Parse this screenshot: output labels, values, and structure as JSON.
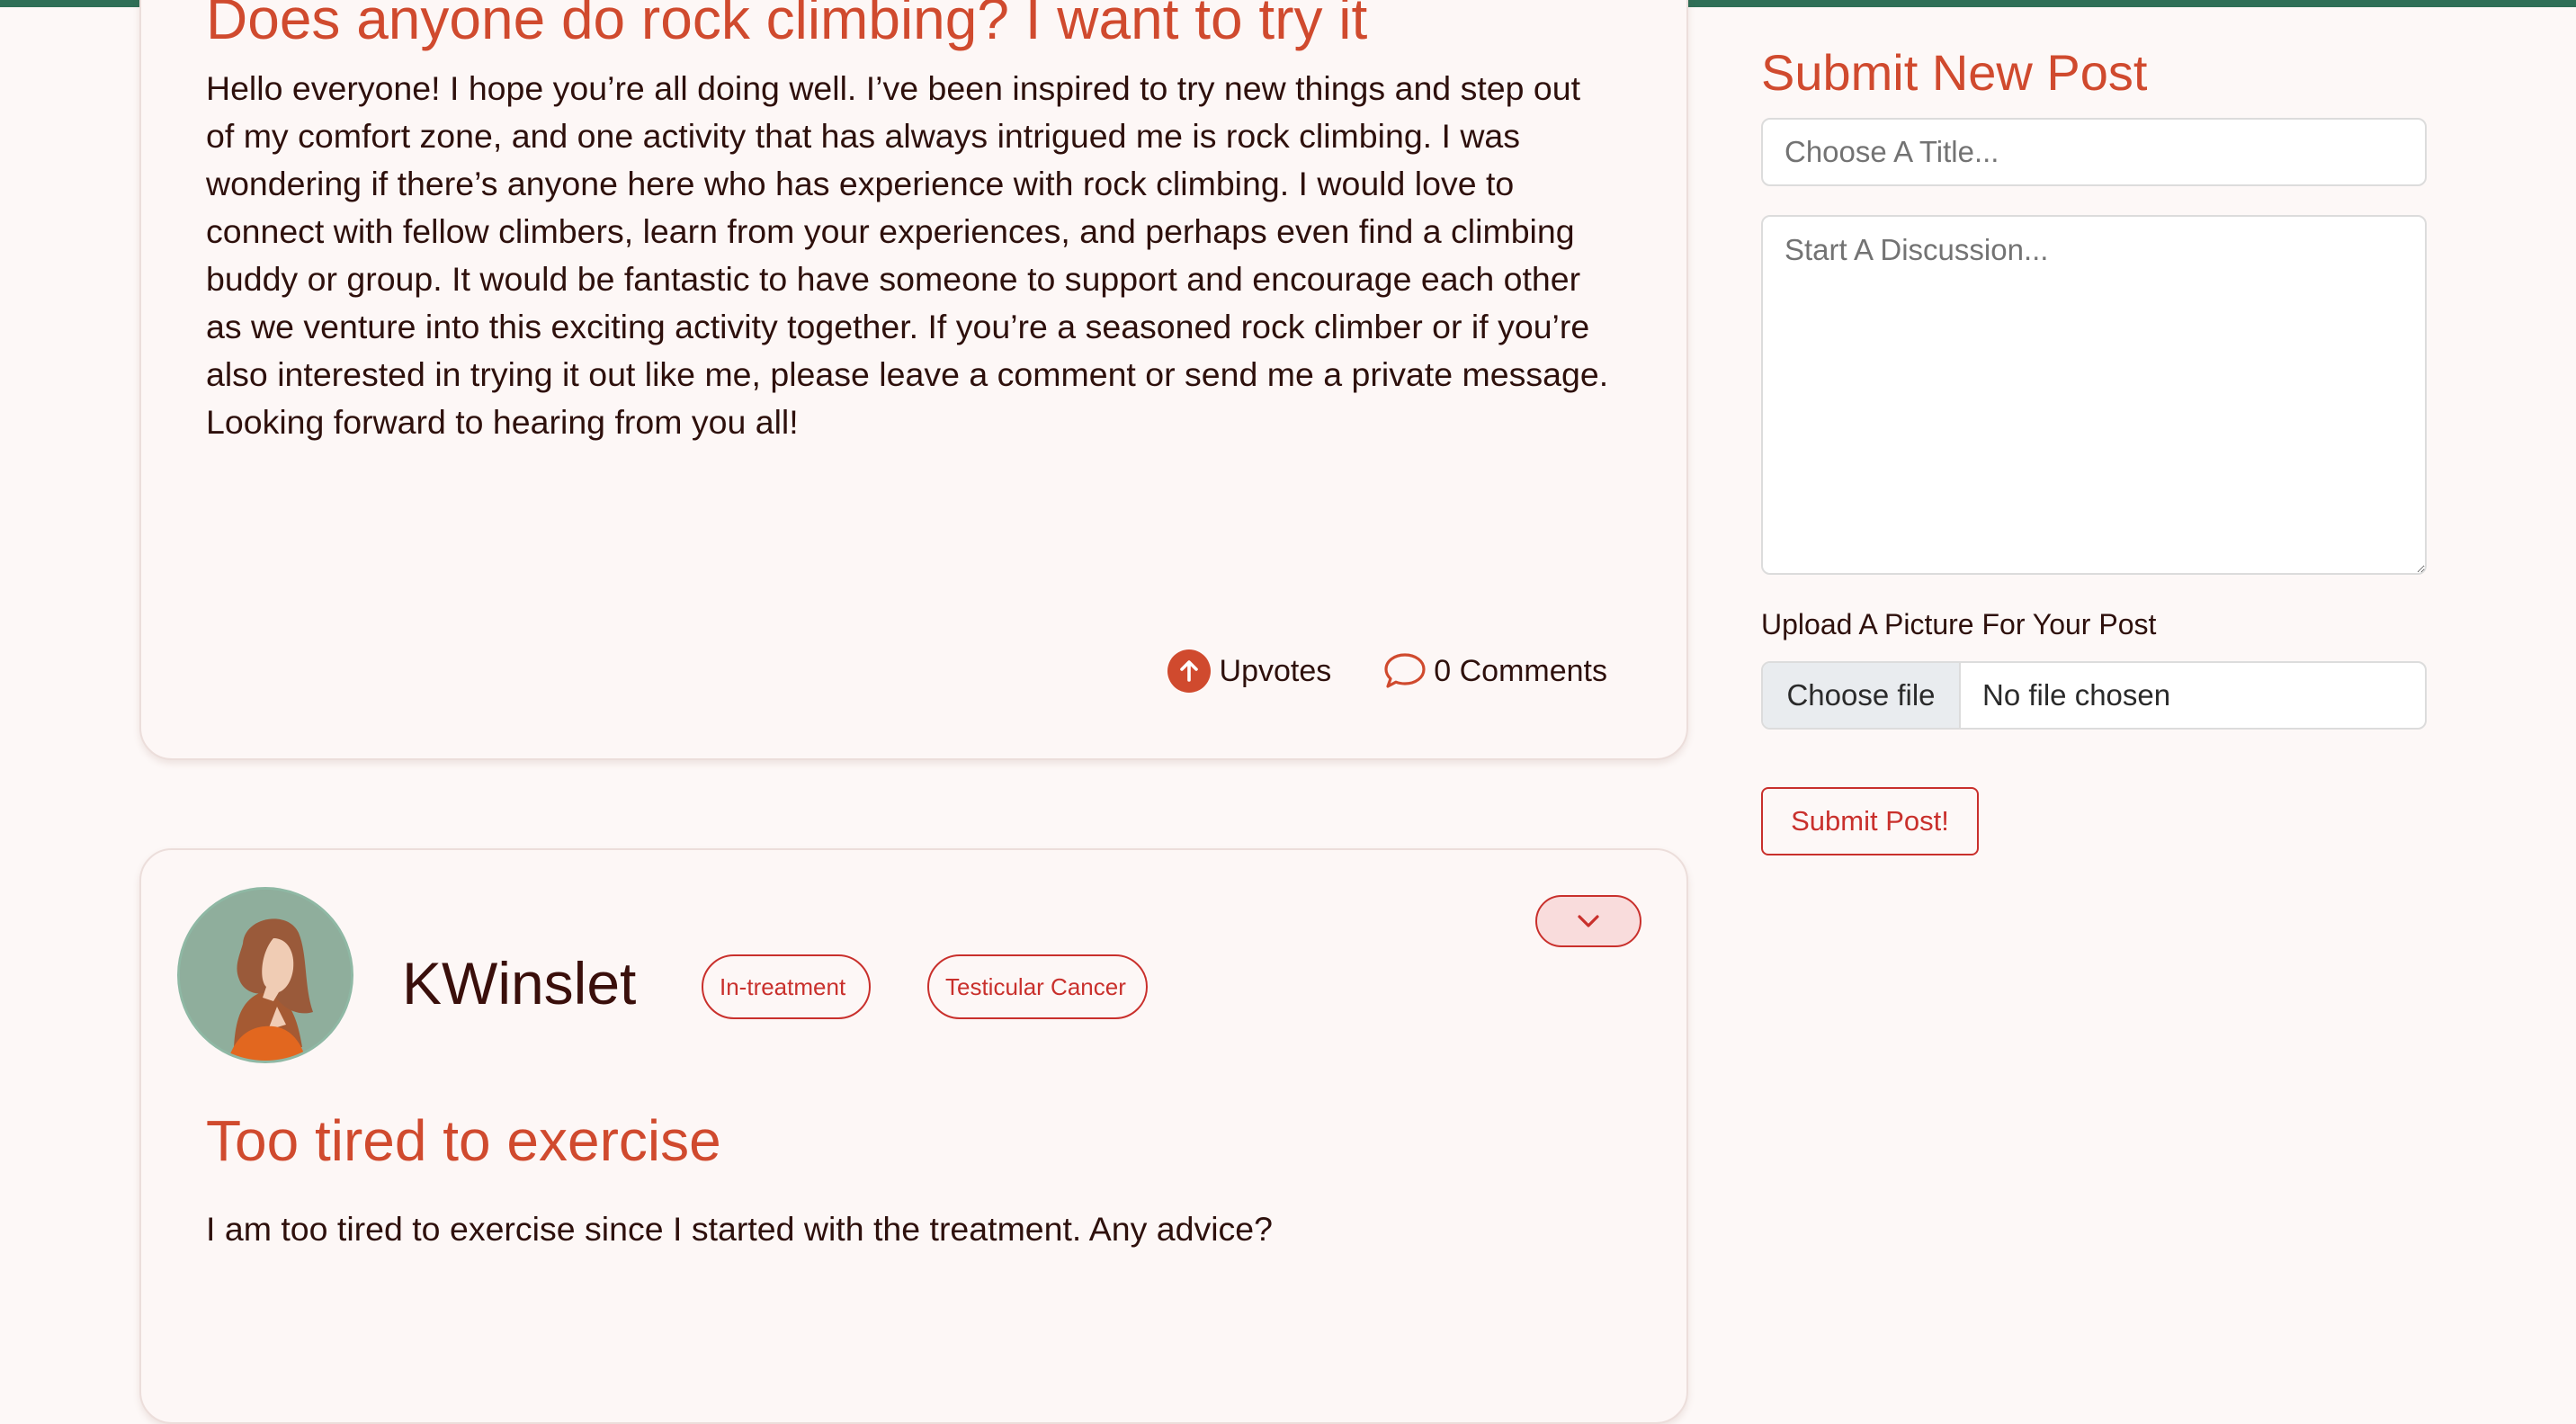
{
  "posts": [
    {
      "title": "Does anyone do rock climbing? I want to try it",
      "body": "Hello everyone! I hope you’re all doing well. I’ve been inspired to try new things and step out of my comfort zone, and one activity that has always intrigued me is rock climbing. I was wondering if there’s anyone here who has experience with rock climbing. I would love to connect with fellow climbers, learn from your experiences, and perhaps even find a climbing buddy or group. It would be fantastic to have someone to support and encourage each other as we venture into this exciting activity together. If you’re a seasoned rock climber or if you’re also interested in trying it out like me, please leave a comment or send me a private message. Looking forward to hearing from you all!",
      "upvotes_label": "Upvotes",
      "comments_label": "0 Comments"
    },
    {
      "username": "KWinslet",
      "tags": [
        "In-treatment",
        "Testicular Cancer"
      ],
      "title": "Too tired to exercise",
      "body": "I am too tired to exercise since I started with the treatment. Any advice?"
    }
  ],
  "sidebar": {
    "title": "Submit New Post",
    "title_placeholder": "Choose A Title...",
    "discussion_placeholder": "Start A Discussion...",
    "upload_label": "Upload A Picture For Your Post",
    "choose_file_label": "Choose file",
    "no_file_label": "No file chosen",
    "submit_label": "Submit Post!"
  },
  "icons": {
    "upvote": "arrow-up-circle-icon",
    "comments": "speech-bubble-icon",
    "expand": "chevron-down-icon"
  },
  "colors": {
    "accent": "#d04a2e",
    "tag_border": "#c9302c",
    "top_bar": "#2f6f57",
    "background": "#fdf8f7"
  }
}
